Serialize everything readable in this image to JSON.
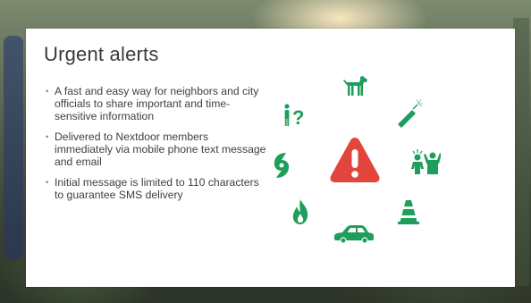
{
  "slide": {
    "title": "Urgent alerts",
    "bullets": [
      {
        "text": "A fast and easy way for neighbors and city officials to share important and time-sensitive information"
      },
      {
        "text": "Delivered to Nextdoor members immediately via mobile phone text message and email"
      },
      {
        "text": "Initial message is limited to 110 characters to guarantee SMS delivery"
      }
    ],
    "bullet_marker": "•"
  },
  "colors": {
    "accent_green": "#1e9e5a",
    "alert_red": "#e2453c",
    "title_text": "#3a3a3a",
    "body_text": "#404040"
  },
  "icons": [
    "missing-person-icon",
    "dog-icon",
    "explosive-icon",
    "hurricane-icon",
    "alert-warning-icon",
    "suspicious-activity-icon",
    "fire-icon",
    "traffic-cone-icon",
    "car-icon"
  ]
}
